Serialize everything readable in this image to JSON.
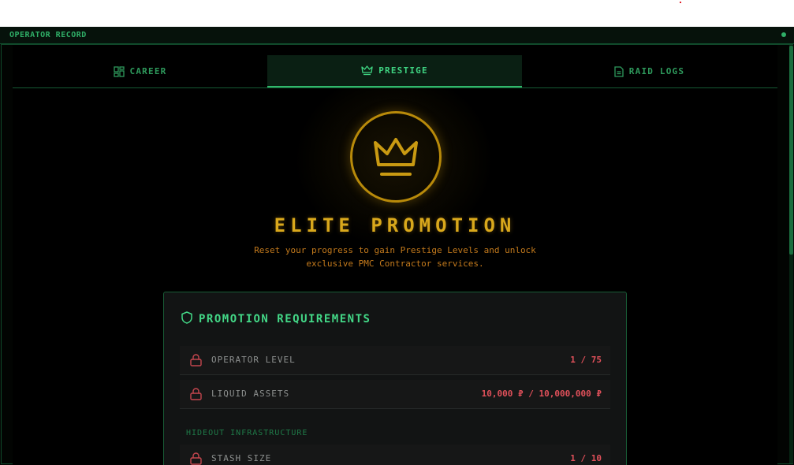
{
  "window": {
    "title": "OPERATOR RECORD"
  },
  "tabs": [
    {
      "label": "CAREER",
      "icon": "dashboard-icon",
      "active": false
    },
    {
      "label": "PRESTIGE",
      "icon": "crown-icon",
      "active": true
    },
    {
      "label": "RAID LOGS",
      "icon": "document-icon",
      "active": false
    }
  ],
  "hero": {
    "icon": "crown-icon",
    "title": "ELITE PROMOTION",
    "subtitle_line1": "Reset your progress to gain Prestige Levels and unlock",
    "subtitle_line2": "exclusive PMC Contractor services."
  },
  "requirements": {
    "heading": "PROMOTION REQUIREMENTS",
    "heading_icon": "shield-icon",
    "items": [
      {
        "label": "OPERATOR LEVEL",
        "value": "1 / 75",
        "icon": "lock-icon"
      },
      {
        "label": "LIQUID ASSETS",
        "value": "10,000 ₽ / 10,000,000 ₽",
        "icon": "lock-icon"
      }
    ],
    "section_label": "HIDEOUT INFRASTRUCTURE",
    "hideout_items": [
      {
        "label": "STASH SIZE",
        "value": "1 / 10",
        "icon": "lock-icon"
      }
    ]
  },
  "colors": {
    "accent_green": "#3fd482",
    "gold": "#d9a81c",
    "warning_red": "#e0505a",
    "background": "#000000"
  }
}
